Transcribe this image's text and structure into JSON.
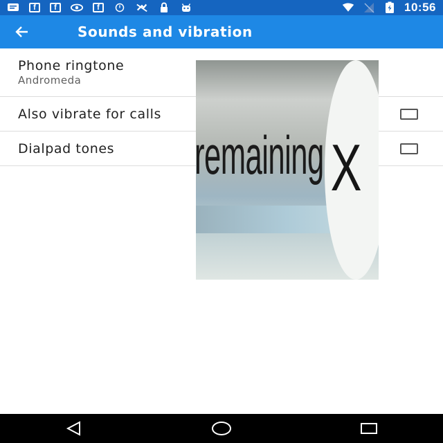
{
  "status_bar": {
    "time": "10:56",
    "left_icons": [
      "message-icon",
      "facebook-icon",
      "facebook-icon",
      "eye-icon",
      "facebook-icon",
      "alarm-icon",
      "no-sim-icon",
      "lock-icon",
      "android-icon"
    ],
    "right_icons": [
      "wifi-icon",
      "signal-icon",
      "battery-charging-icon"
    ],
    "fb_glyph": "f"
  },
  "app_bar": {
    "title": "Sounds and vibration",
    "back_icon": "arrow-back-icon",
    "color": "#1e88e5",
    "status_color": "#1565c0"
  },
  "settings": {
    "ringtone": {
      "title": "Phone ringtone",
      "summary": "Andromeda"
    },
    "vibrate": {
      "title": "Also vibrate for calls",
      "checked": false
    },
    "dialpad": {
      "title": "Dialpad tones",
      "checked": false
    }
  },
  "ad": {
    "text": "remaining",
    "close_glyph": "X"
  },
  "nav_bar": {
    "icons": [
      "back-triangle-icon",
      "home-circle-icon",
      "recents-square-icon"
    ]
  }
}
